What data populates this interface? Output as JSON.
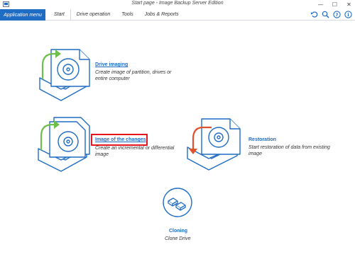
{
  "window": {
    "title": "Start page - Image Backup Server Edition",
    "controls": {
      "minimize": "—",
      "maximize": "☐",
      "close": "✕"
    }
  },
  "menubar": {
    "app_menu": "Application menu",
    "tabs": [
      "Start",
      "Drive operation",
      "Tools",
      "Jobs & Reports"
    ],
    "toolbar_icons": [
      "undo-icon",
      "zoom-icon",
      "help-icon",
      "info-icon"
    ]
  },
  "tiles": {
    "drive_imaging": {
      "label": "Drive imaging",
      "desc1": "Create image of partition, drives or",
      "desc2": "entire computer"
    },
    "image_changes": {
      "label": "Image of the changes",
      "desc1": "Create an incremental or differential",
      "desc2": "image"
    },
    "restoration": {
      "label": "Restoration",
      "desc1": "Start restoration of data from existing",
      "desc2": "image"
    },
    "cloning": {
      "label": "Cloning",
      "desc1": "Clone Drive"
    }
  },
  "colors": {
    "accent": "#1f6cc4",
    "green_arrow": "#6cc04a",
    "red_arrow": "#e0522b",
    "highlight": "#e8141c"
  }
}
